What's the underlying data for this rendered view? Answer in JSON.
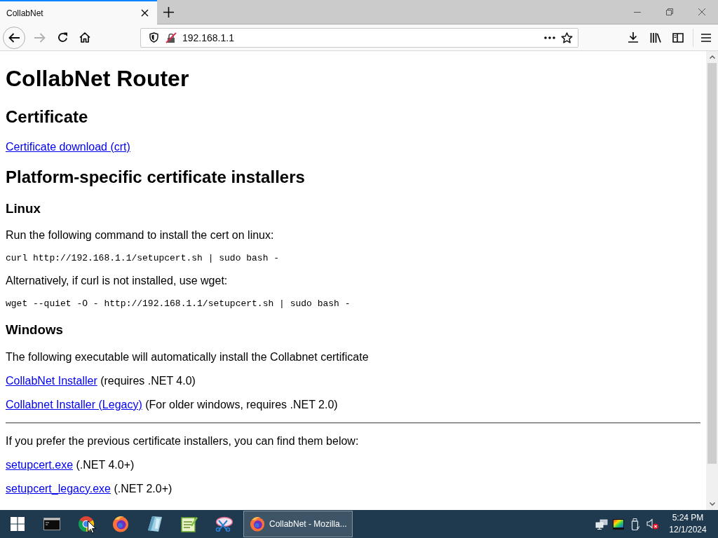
{
  "browser": {
    "tabs": [
      {
        "title": "CollabNet",
        "selected": true
      }
    ],
    "back": {
      "disabled": false
    },
    "forward": {
      "disabled": true
    },
    "address": "192.168.1.1"
  },
  "page": {
    "blocks": [
      {
        "kind": "h1",
        "text": "CollabNet Router"
      },
      {
        "kind": "h2",
        "text": "Certificate"
      },
      {
        "kind": "link",
        "link": "Certificate download (crt)"
      },
      {
        "kind": "h2",
        "text": "Platform-specific certificate installers"
      },
      {
        "kind": "h3",
        "text": "Linux"
      },
      {
        "kind": "text",
        "text": "Run the following command to install the cert on linux:"
      },
      {
        "kind": "code",
        "text": "curl http://192.168.1.1/setupcert.sh | sudo bash -"
      },
      {
        "kind": "text",
        "text": "Alternatively, if curl is not installed, use wget:"
      },
      {
        "kind": "code",
        "text": "wget --quiet -O - http://192.168.1.1/setupcert.sh | sudo bash -"
      },
      {
        "kind": "h3",
        "text": "Windows"
      },
      {
        "kind": "text",
        "text": "The following executable will automatically install the Collabnet certificate"
      },
      {
        "kind": "link",
        "link": "CollabNet Installer",
        "note": "(requires .NET 4.0)"
      },
      {
        "kind": "link",
        "link": "Collabnet Installer (Legacy)",
        "note": "(For older windows, requires .NET 2.0)"
      },
      {
        "kind": "rule"
      },
      {
        "kind": "text",
        "text": "If you prefer the previous certificate installers, you can find them below:"
      },
      {
        "kind": "link",
        "link": "setupcert.exe",
        "note": "(.NET 4.0+)"
      },
      {
        "kind": "link",
        "link": "setupcert_legacy.exe",
        "note": "(.NET 2.0+)"
      }
    ]
  },
  "taskbar": {
    "windows": [
      {
        "title": "CollabNet - Mozilla...",
        "selected": true
      }
    ],
    "clock": {
      "time": "5:24 PM",
      "date": "12/1/2024"
    }
  }
}
